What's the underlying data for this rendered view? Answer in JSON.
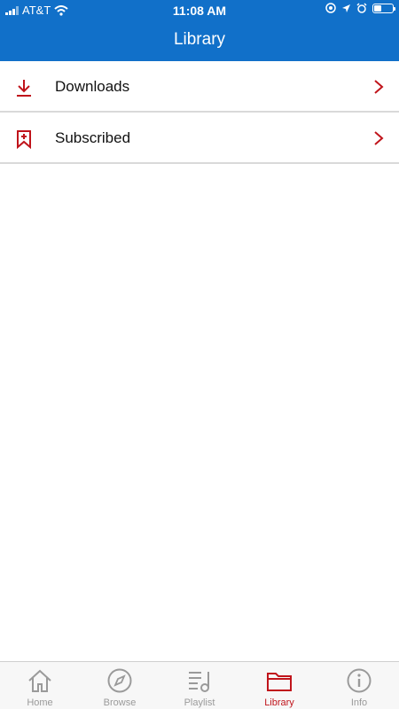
{
  "status_bar": {
    "carrier": "AT&T",
    "time": "11:08 AM"
  },
  "header": {
    "title": "Library"
  },
  "list": [
    {
      "label": "Downloads",
      "icon": "download-icon"
    },
    {
      "label": "Subscribed",
      "icon": "bookmark-plus-icon"
    }
  ],
  "tabs": [
    {
      "label": "Home",
      "icon": "home-icon",
      "active": false
    },
    {
      "label": "Browse",
      "icon": "compass-icon",
      "active": false
    },
    {
      "label": "Playlist",
      "icon": "playlist-icon",
      "active": false
    },
    {
      "label": "Library",
      "icon": "folder-icon",
      "active": true
    },
    {
      "label": "Info",
      "icon": "info-icon",
      "active": false
    }
  ],
  "colors": {
    "header_bg": "#1170c9",
    "accent": "#c0141b",
    "inactive": "#9a9a9a"
  }
}
